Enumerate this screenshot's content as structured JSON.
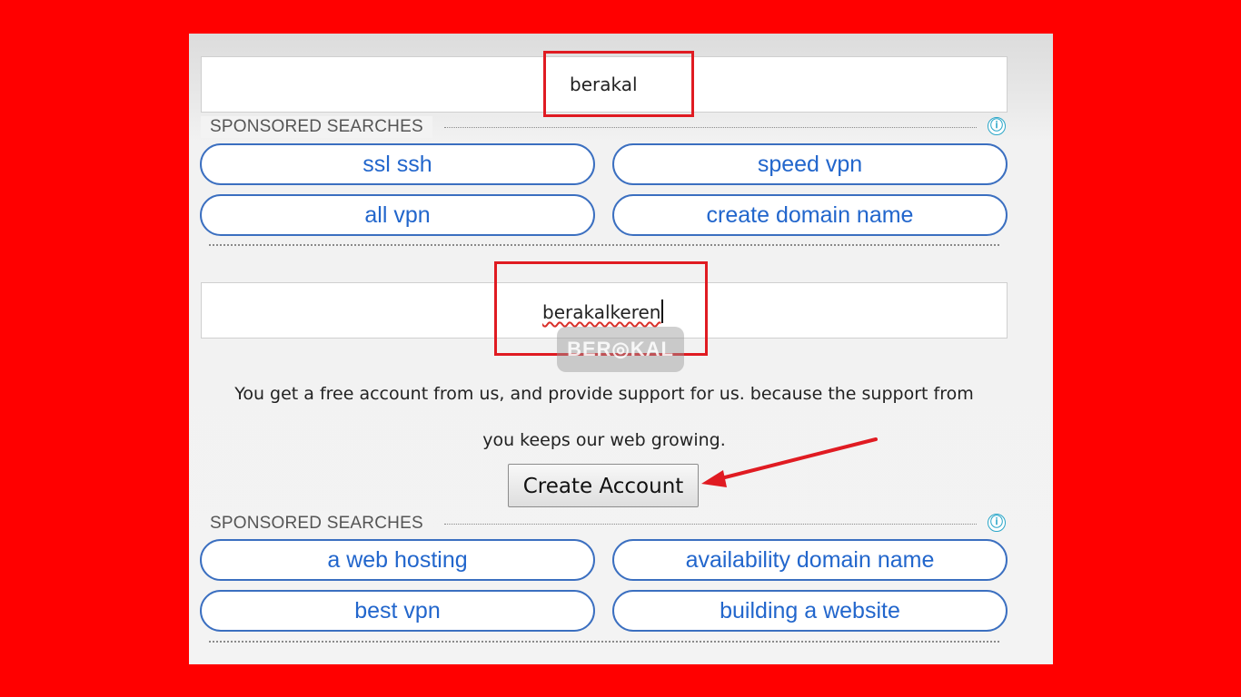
{
  "form": {
    "username_value": "berakal",
    "password_value": "berakalkeren",
    "description_line1": "You get a free account from us, and provide support for us. because the support from",
    "description_line2": "you keeps our web growing.",
    "create_button_label": "Create Account"
  },
  "sponsored_top": {
    "label": "SPONSORED SEARCHES",
    "info_icon": "ⓘ",
    "items": [
      "ssl ssh",
      "speed vpn",
      "all vpn",
      "create domain name"
    ]
  },
  "sponsored_bottom": {
    "label": "SPONSORED SEARCHES",
    "info_icon": "ⓘ",
    "items": [
      "a web hosting",
      "availability domain name",
      "best vpn",
      "building a website"
    ]
  },
  "watermark": "BER◎KAL",
  "colors": {
    "background": "#ff0000",
    "highlight": "#e01b22",
    "link": "#2266cc",
    "pill_border": "#3b6fc0"
  }
}
